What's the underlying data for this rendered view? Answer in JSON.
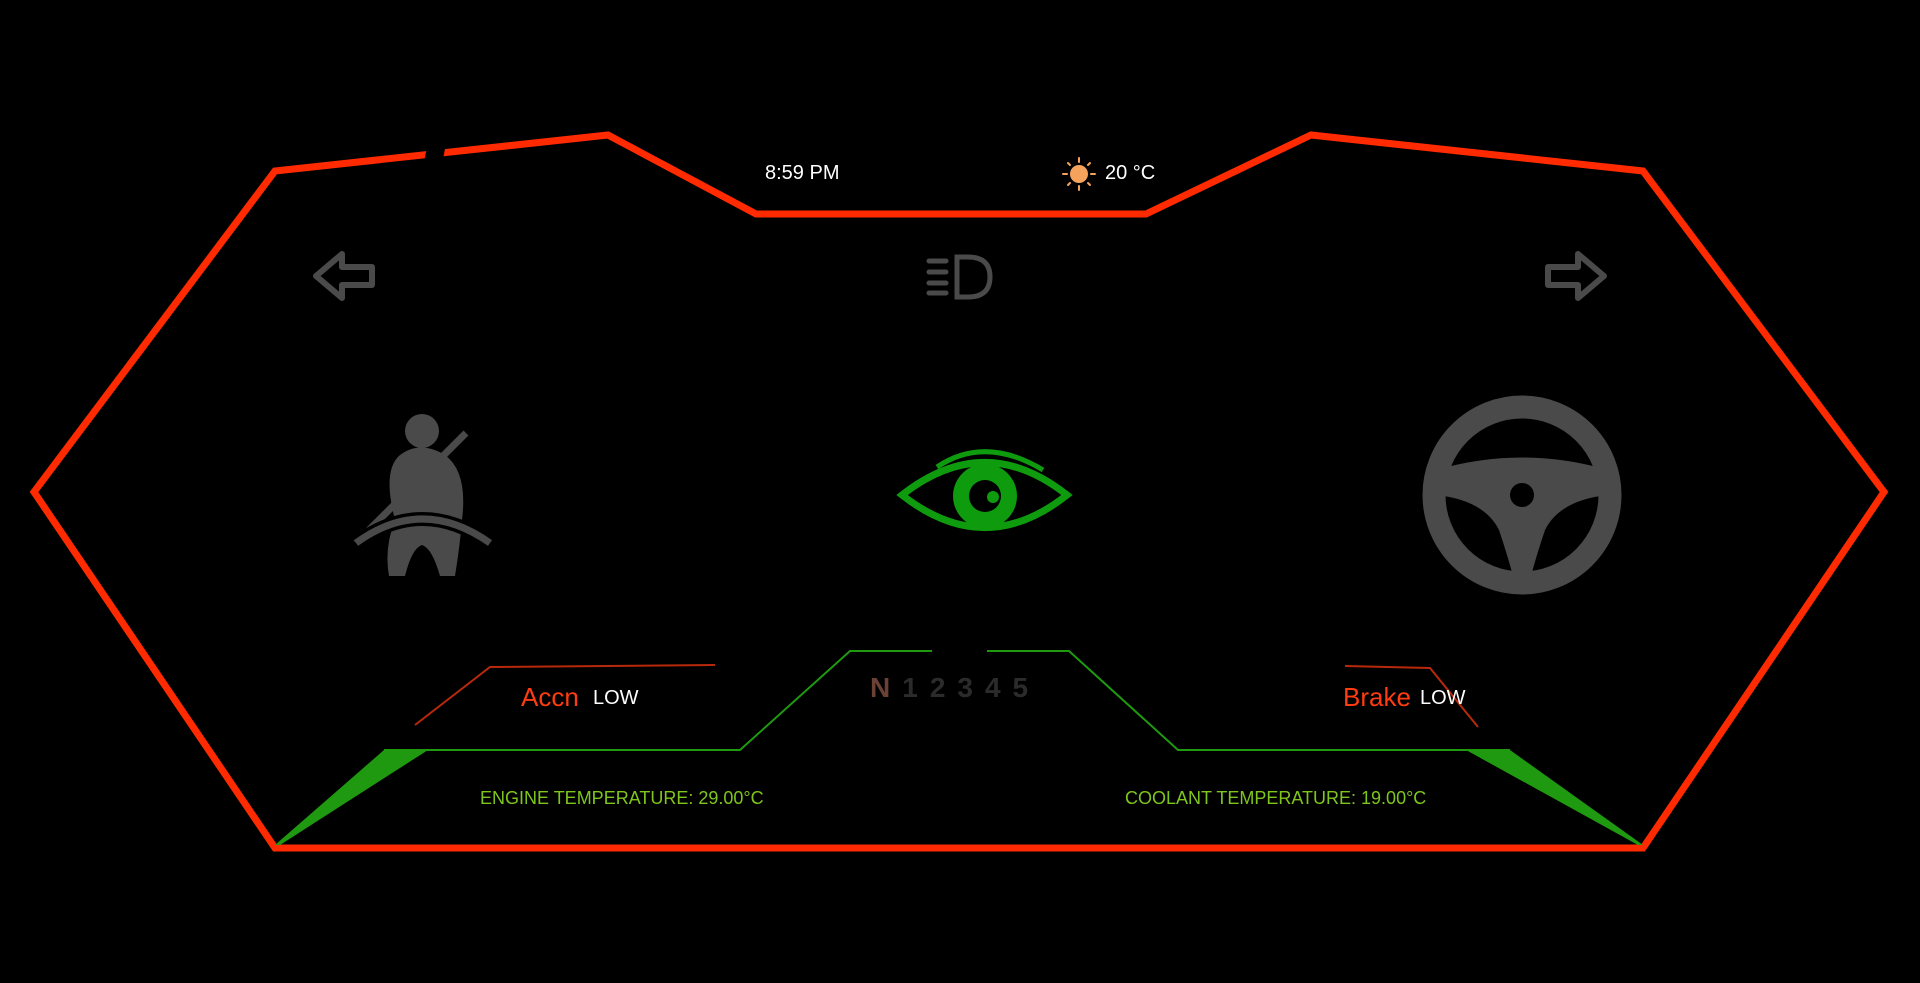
{
  "status_bar": {
    "time": "8:59 PM",
    "weather_icon": "sun-icon",
    "outside_temperature": "20 °C"
  },
  "indicators": {
    "left_turn_icon": "arrow-left-icon",
    "right_turn_icon": "arrow-right-icon",
    "headlight_icon": "low-beam-headlight-icon",
    "seatbelt_icon": "seatbelt-icon",
    "driver_monitor_icon": "eye-icon",
    "steering_icon": "steering-wheel-icon"
  },
  "pedals": {
    "accel_label": "Accn",
    "accel_level": "LOW",
    "brake_label": "Brake",
    "brake_level": "LOW"
  },
  "gear_selector": {
    "gears": [
      "N",
      "1",
      "2",
      "3",
      "4",
      "5"
    ],
    "selected": "N"
  },
  "temperatures": {
    "engine": "ENGINE TEMPERATURE: 29.00°C",
    "coolant": "COOLANT TEMPERATURE: 19.00°C"
  },
  "colors": {
    "frame": "#ff2a00",
    "accent_green": "#1f9a10",
    "eye_green": "#0e9c0e",
    "inactive_icon": "#4a4a4a",
    "label_red": "#ff3b12",
    "temp_text": "#7ec61d"
  }
}
